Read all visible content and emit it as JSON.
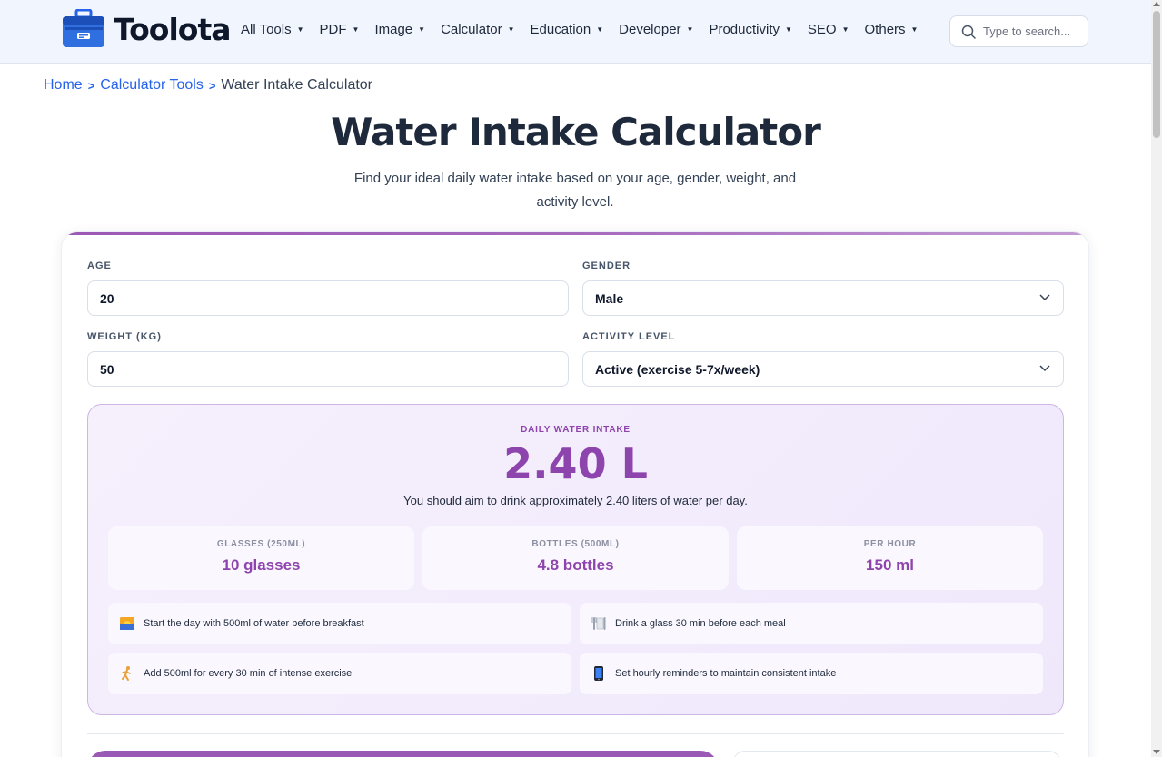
{
  "brand": {
    "name": "Toolota"
  },
  "nav": {
    "items": [
      {
        "label": "All Tools"
      },
      {
        "label": "PDF"
      },
      {
        "label": "Image"
      },
      {
        "label": "Calculator"
      },
      {
        "label": "Education"
      },
      {
        "label": "Developer"
      },
      {
        "label": "Productivity"
      },
      {
        "label": "SEO"
      },
      {
        "label": "Others"
      }
    ],
    "search_placeholder": "Type to search..."
  },
  "breadcrumb": {
    "home": "Home",
    "category": "Calculator Tools",
    "current": "Water Intake Calculator"
  },
  "page": {
    "title": "Water Intake Calculator",
    "subtitle": "Find your ideal daily water intake based on your age, gender, weight, and activity level."
  },
  "form": {
    "age_label": "AGE",
    "age_value": "20",
    "gender_label": "GENDER",
    "gender_value": "Male",
    "weight_label": "WEIGHT (KG)",
    "weight_value": "50",
    "activity_label": "ACTIVITY LEVEL",
    "activity_value": "Active (exercise 5-7x/week)"
  },
  "result": {
    "label": "DAILY WATER INTAKE",
    "value": "2.40 L",
    "description": "You should aim to drink approximately 2.40 liters of water per day.",
    "stats": [
      {
        "label": "GLASSES (250ML)",
        "value": "10 glasses"
      },
      {
        "label": "BOTTLES (500ML)",
        "value": "4.8 bottles"
      },
      {
        "label": "PER HOUR",
        "value": "150 ml"
      }
    ],
    "tips": [
      {
        "icon": "sunrise-icon",
        "text": "Start the day with 500ml of water before breakfast"
      },
      {
        "icon": "utensils-icon",
        "text": "Drink a glass 30 min before each meal"
      },
      {
        "icon": "running-icon",
        "text": "Add 500ml for every 30 min of intense exercise"
      },
      {
        "icon": "phone-icon",
        "text": "Set hourly reminders to maintain consistent intake"
      }
    ]
  },
  "colors": {
    "accent": "#8e44ad",
    "link": "#2563eb",
    "logo": "#2f6fe0"
  }
}
